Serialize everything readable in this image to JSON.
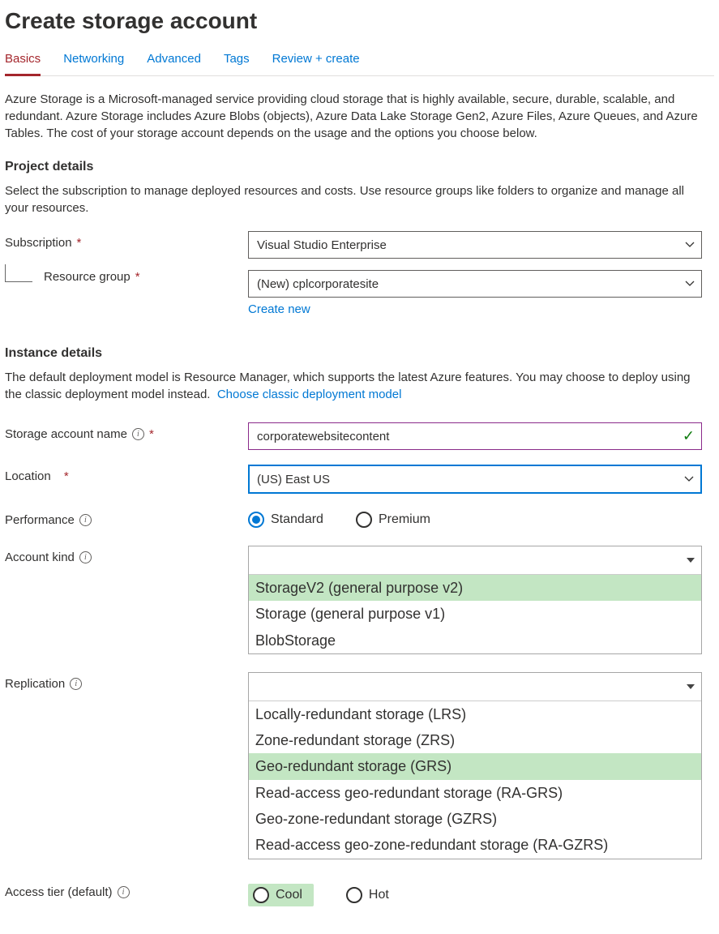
{
  "page": {
    "title": "Create storage account",
    "tabs": [
      {
        "label": "Basics",
        "active": true
      },
      {
        "label": "Networking",
        "active": false
      },
      {
        "label": "Advanced",
        "active": false
      },
      {
        "label": "Tags",
        "active": false
      },
      {
        "label": "Review + create",
        "active": false
      }
    ],
    "intro": "Azure Storage is a Microsoft-managed service providing cloud storage that is highly available, secure, durable, scalable, and redundant. Azure Storage includes Azure Blobs (objects), Azure Data Lake Storage Gen2, Azure Files, Azure Queues, and Azure Tables. The cost of your storage account depends on the usage and the options you choose below."
  },
  "project_details": {
    "heading": "Project details",
    "desc": "Select the subscription to manage deployed resources and costs. Use resource groups like folders to organize and manage all your resources.",
    "subscription": {
      "label": "Subscription",
      "value": "Visual Studio Enterprise"
    },
    "resource_group": {
      "label": "Resource group",
      "value": "(New) cplcorporatesite",
      "create_new": "Create new"
    }
  },
  "instance_details": {
    "heading": "Instance details",
    "desc": "The default deployment model is Resource Manager, which supports the latest Azure features. You may choose to deploy using the classic deployment model instead.",
    "classic_link": "Choose classic deployment model",
    "storage_name": {
      "label": "Storage account name",
      "value": "corporatewebsitecontent"
    },
    "location": {
      "label": "Location",
      "value": "(US) East US"
    },
    "performance": {
      "label": "Performance",
      "options": [
        {
          "label": "Standard",
          "selected": true
        },
        {
          "label": "Premium",
          "selected": false
        }
      ]
    },
    "account_kind": {
      "label": "Account kind",
      "selected": "",
      "options": [
        {
          "label": "StorageV2 (general purpose v2)",
          "highlight": true
        },
        {
          "label": "Storage (general purpose v1)",
          "highlight": false
        },
        {
          "label": "BlobStorage",
          "highlight": false
        }
      ]
    },
    "replication": {
      "label": "Replication",
      "selected": "",
      "options": [
        {
          "label": "Locally-redundant storage (LRS)",
          "highlight": false
        },
        {
          "label": "Zone-redundant storage (ZRS)",
          "highlight": false
        },
        {
          "label": "Geo-redundant storage (GRS)",
          "highlight": true
        },
        {
          "label": "Read-access geo-redundant storage (RA-GRS)",
          "highlight": false
        },
        {
          "label": "Geo-zone-redundant storage (GZRS)",
          "highlight": false
        },
        {
          "label": "Read-access geo-zone-redundant storage (RA-GZRS)",
          "highlight": false
        }
      ]
    },
    "access_tier": {
      "label": "Access tier (default)",
      "options": [
        {
          "label": "Cool",
          "selected": false,
          "highlight": true
        },
        {
          "label": "Hot",
          "selected": false,
          "highlight": false
        }
      ]
    }
  }
}
